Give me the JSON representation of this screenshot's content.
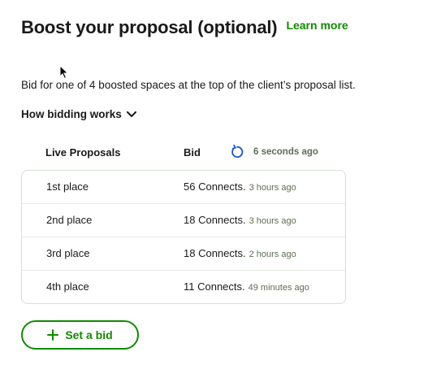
{
  "header": {
    "title": "Boost your proposal (optional)",
    "learn_more": "Learn more"
  },
  "description": "Bid for one of 4 boosted spaces at the top of the client’s proposal list.",
  "how_bidding": {
    "label": "How bidding works",
    "icon": "chevron-down-icon"
  },
  "table": {
    "col_live": "Live Proposals",
    "col_bid": "Bid",
    "refresh_icon": "refresh-icon",
    "updated": "6 seconds ago",
    "rows": [
      {
        "place": "1st place",
        "bid": "56 Connects.",
        "time": "3 hours ago"
      },
      {
        "place": "2nd place",
        "bid": "18 Connects.",
        "time": "3 hours ago"
      },
      {
        "place": "3rd place",
        "bid": "18 Connects.",
        "time": "2 hours ago"
      },
      {
        "place": "4th place",
        "bid": "11 Connects.",
        "time": "49 minutes ago"
      }
    ]
  },
  "set_bid_button": {
    "label": "Set a bid",
    "icon": "plus-icon"
  },
  "colors": {
    "accent": "#108a00",
    "text": "#1a1a1a",
    "muted": "#5e6d55",
    "border": "#d5e0d5",
    "refresh": "#1f57c3"
  }
}
